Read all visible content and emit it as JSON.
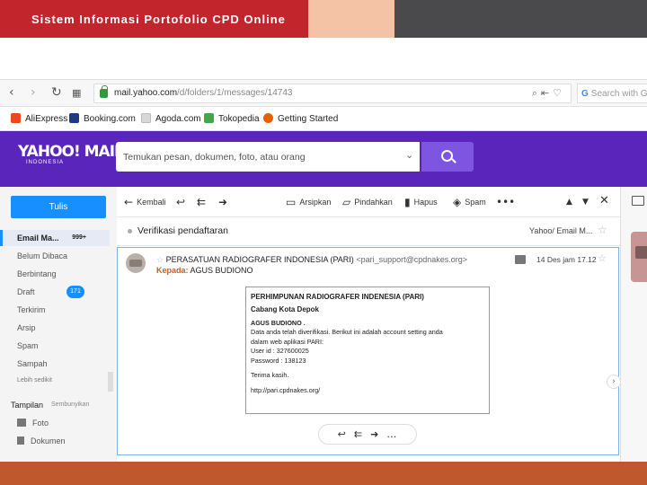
{
  "slide": {
    "title": "Sistem Informasi Portofolio CPD Online"
  },
  "browser": {
    "url_host": "mail.yahoo.com",
    "url_path": "/d/folders/1/messages/14743",
    "search_placeholder": "Search with Go",
    "bookmarks": [
      "AliExpress",
      "Booking.com",
      "Agoda.com",
      "Tokopedia",
      "Getting Started"
    ]
  },
  "yahoo": {
    "logo": "YAHOO! MAIL",
    "logo_sub": "INDONESIA",
    "search_placeholder": "Temukan pesan, dokumen, foto, atau orang"
  },
  "sidebar": {
    "compose": "Tulis",
    "folders": [
      {
        "label": "Email Ma...",
        "count": "999+"
      },
      {
        "label": "Belum Dibaca"
      },
      {
        "label": "Berbintang"
      },
      {
        "label": "Draft",
        "count": "171"
      },
      {
        "label": "Terkirim"
      },
      {
        "label": "Arsip"
      },
      {
        "label": "Spam"
      },
      {
        "label": "Sampah"
      }
    ],
    "more": "Lebih sedikit",
    "views_title": "Tampilan",
    "views_hide": "Sembunyikan",
    "views": [
      "Foto",
      "Dokumen"
    ]
  },
  "toolbar": {
    "back": "Kembali",
    "archive": "Arsipkan",
    "move": "Pindahkan",
    "delete": "Hapus",
    "spam": "Spam"
  },
  "message": {
    "subject": "Verifikasi pendaftaran",
    "folder": "Yahoo/ Email M...",
    "sender_name": "PERASATUAN RADIOGRAFER INDONESIA (PARI)",
    "sender_email": "<pari_support@cpdnakes.org>",
    "to_label": "Kepada:",
    "to_name": "AGUS BUDIONO",
    "date": "14 Des jam 17.12",
    "body": {
      "org": "PERHIMPUNAN RADIOGRAFER INDENESIA (PARI)",
      "branch": "Cabang Kota Depok",
      "name": "AGUS BUDIONO .",
      "line1": "Data anda telah diverifikasi. Berikut ini adalah account setting anda",
      "line2": "dalam web aplikasi PARI:",
      "userid": "User id : 327600025",
      "password": "Password : 138123",
      "thanks": "Terima kasih.",
      "link": "http://pari.cpdnakes.org/"
    }
  }
}
